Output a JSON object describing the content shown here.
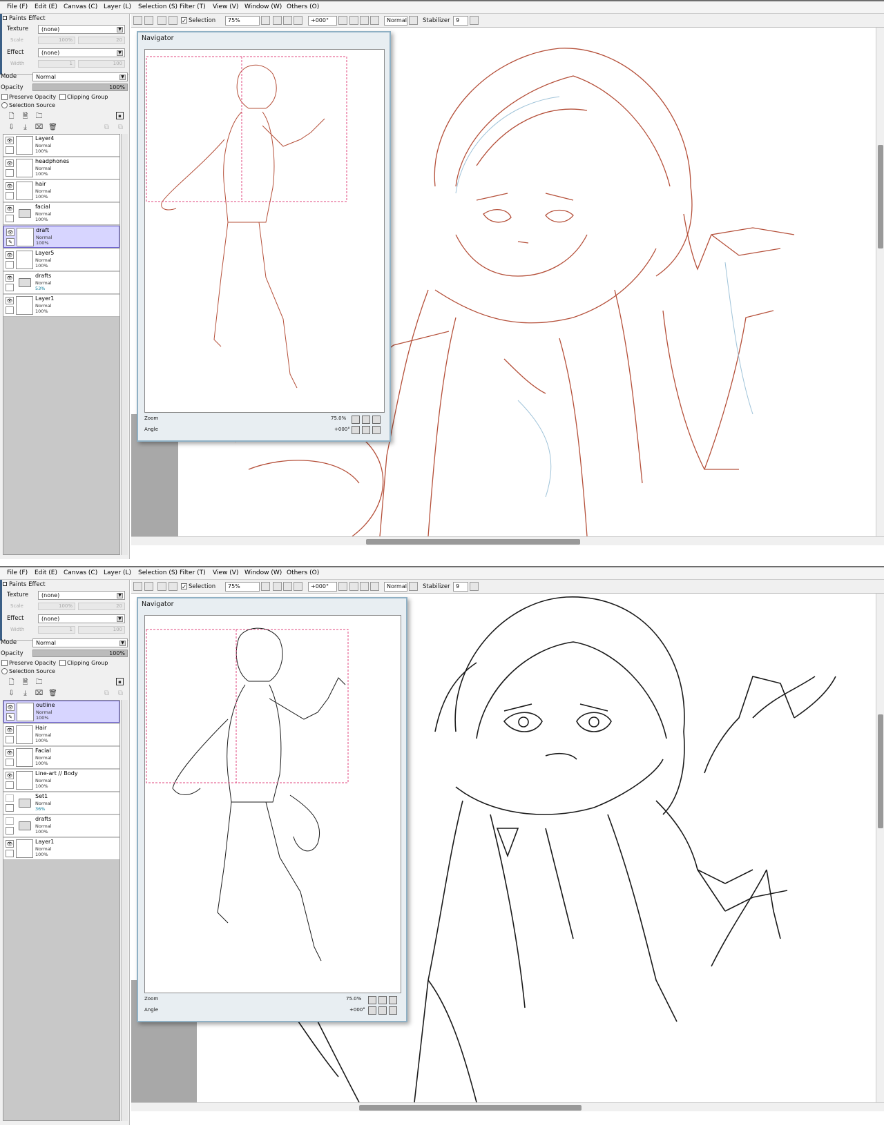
{
  "screens": [
    {
      "menu": [
        "File (F)",
        "Edit (E)",
        "Canvas (C)",
        "Layer (L)",
        "Selection (S)",
        "Filter (T)",
        "View (V)",
        "Window (W)",
        "Others (O)"
      ],
      "paints_effect": {
        "title": "Paints Effect",
        "texture_label": "Texture",
        "texture_value": "(none)",
        "scale_label": "Scale",
        "scale_value": "100%",
        "scale_num": "20",
        "effect_label": "Effect",
        "effect_value": "(none)",
        "width_label": "Width",
        "width_value": "1",
        "width_num": "100"
      },
      "mode": {
        "label": "Mode",
        "value": "Normal"
      },
      "opacity": {
        "label": "Opacity",
        "value": "100%"
      },
      "options": {
        "preserve": "Preserve Opacity",
        "clipping": "Clipping Group",
        "selection_source": "Selection Source"
      },
      "layers": [
        {
          "name": "Layer4",
          "mode": "Normal",
          "opacity": "100%",
          "folder": false,
          "selected": false
        },
        {
          "name": "headphones",
          "mode": "Normal",
          "opacity": "100%",
          "folder": false,
          "selected": false
        },
        {
          "name": "hair",
          "mode": "Normal",
          "opacity": "100%",
          "folder": false,
          "selected": false
        },
        {
          "name": "facial",
          "mode": "Normal",
          "opacity": "100%",
          "folder": true,
          "selected": false
        },
        {
          "name": "draft",
          "mode": "Normal",
          "opacity": "100%",
          "folder": false,
          "selected": true
        },
        {
          "name": "Layer5",
          "mode": "Normal",
          "opacity": "100%",
          "folder": false,
          "selected": false
        },
        {
          "name": "drafts",
          "mode": "Normal",
          "opacity": "53%",
          "folder": true,
          "selected": false
        },
        {
          "name": "Layer1",
          "mode": "Normal",
          "opacity": "100%",
          "folder": false,
          "selected": false
        }
      ],
      "toolbar": {
        "selection": "Selection",
        "zoom": "75%",
        "angle": "+000°",
        "blend": "Normal",
        "stabilizer_label": "Stabilizer",
        "stabilizer_value": "9"
      },
      "navigator": {
        "title": "Navigator",
        "zoom_label": "Zoom",
        "zoom_value": "75.0%",
        "angle_label": "Angle",
        "angle_value": "+000°"
      },
      "line_color": "#b5503a"
    },
    {
      "menu": [
        "File (F)",
        "Edit (E)",
        "Canvas (C)",
        "Layer (L)",
        "Selection (S)",
        "Filter (T)",
        "View (V)",
        "Window (W)",
        "Others (O)"
      ],
      "paints_effect": {
        "title": "Paints Effect",
        "texture_label": "Texture",
        "texture_value": "(none)",
        "scale_label": "Scale",
        "scale_value": "100%",
        "scale_num": "20",
        "effect_label": "Effect",
        "effect_value": "(none)",
        "width_label": "Width",
        "width_value": "1",
        "width_num": "100"
      },
      "mode": {
        "label": "Mode",
        "value": "Normal"
      },
      "opacity": {
        "label": "Opacity",
        "value": "100%"
      },
      "options": {
        "preserve": "Preserve Opacity",
        "clipping": "Clipping Group",
        "selection_source": "Selection Source"
      },
      "layers": [
        {
          "name": "outline",
          "mode": "Normal",
          "opacity": "100%",
          "folder": false,
          "selected": true
        },
        {
          "name": "Hair",
          "mode": "Normal",
          "opacity": "100%",
          "folder": false,
          "selected": false
        },
        {
          "name": "Facial",
          "mode": "Normal",
          "opacity": "100%",
          "folder": false,
          "selected": false
        },
        {
          "name": "Line-art // Body",
          "mode": "Normal",
          "opacity": "100%",
          "folder": false,
          "selected": false
        },
        {
          "name": "Set1",
          "mode": "Normal",
          "opacity": "36%",
          "folder": true,
          "selected": false
        },
        {
          "name": "drafts",
          "mode": "Normal",
          "opacity": "100%",
          "folder": true,
          "selected": false
        },
        {
          "name": "Layer1",
          "mode": "Normal",
          "opacity": "100%",
          "folder": false,
          "selected": false
        }
      ],
      "toolbar": {
        "selection": "Selection",
        "zoom": "75%",
        "angle": "+000°",
        "blend": "Normal",
        "stabilizer_label": "Stabilizer",
        "stabilizer_value": "9"
      },
      "navigator": {
        "title": "Navigator",
        "zoom_label": "Zoom",
        "zoom_value": "75.0%",
        "angle_label": "Angle",
        "angle_value": "+000°"
      },
      "line_color": "#1a1a1a"
    }
  ]
}
